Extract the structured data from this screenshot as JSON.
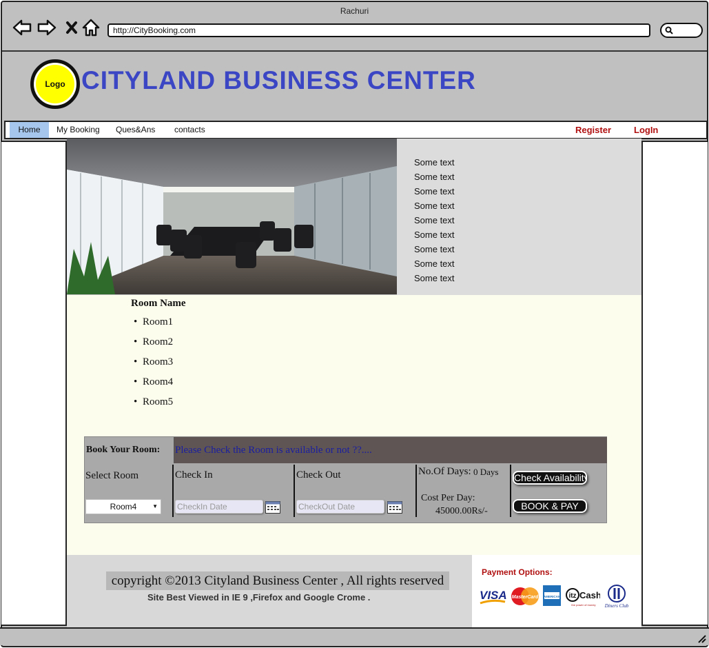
{
  "window": {
    "title": "Rachuri",
    "url": "http://CityBooking.com"
  },
  "header": {
    "logo_text": "Logo",
    "site_title": "CITYLAND BUSINESS CENTER"
  },
  "nav": {
    "items": [
      "Home",
      "My Booking",
      "Ques&Ans",
      "contacts"
    ],
    "active": "Home",
    "register": "Register",
    "login": "LogIn"
  },
  "hero": {
    "lines": [
      "Some text",
      "Some text",
      "Some text",
      "Some text",
      "Some text",
      "Some text",
      "Some text",
      "Some text",
      "Some text"
    ]
  },
  "rooms": {
    "title": "Room Name",
    "items": [
      "Room1",
      "Room2",
      "Room3",
      "Room4",
      "Room5"
    ]
  },
  "booking": {
    "head_label": "Book Your Room:",
    "head_message": "Please Check the Room is available or not ??....",
    "select_room_label": "Select Room",
    "selected_room": "Room4",
    "check_in_label": "Check In",
    "check_in_placeholder": "CheckIn Date",
    "check_out_label": "Check Out",
    "check_out_placeholder": "CheckOut Date",
    "days_label": "No.Of Days:",
    "days_value": "0 Days",
    "cost_label": "Cost Per Day:",
    "cost_value": "45000.00Rs/-",
    "check_button": "Check Availability",
    "pay_button": "BOOK & PAY"
  },
  "footer": {
    "copyright": "copyright ©2013 Cityland Business Center , All rights reserved",
    "best_viewed": "Site Best Viewed in IE 9 ,Firefox and Google Crome .",
    "payment_title": "Payment Options:",
    "payment_methods": [
      "VISA",
      "MasterCard",
      "American Express",
      "ItzCash",
      "Diners Club"
    ]
  },
  "colors": {
    "title_blue": "#3b46c4",
    "link_red": "#b01010",
    "logo_yellow": "#ffff00",
    "active_tab": "#a6c6ee"
  }
}
